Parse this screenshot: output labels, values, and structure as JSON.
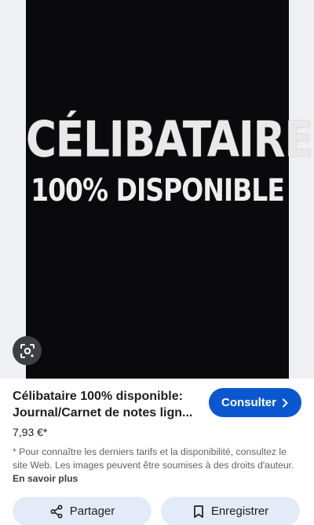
{
  "cover": {
    "title": "CÉLIBATAIRE",
    "subtitle": "100% DISPONIBLE"
  },
  "product": {
    "title_line1": "Célibataire 100% disponible:",
    "title_line2": "Journal/Carnet de notes lign...",
    "price": "7,93 €*"
  },
  "actions": {
    "consult_label": "Consulter",
    "share_label": "Partager",
    "save_label": "Enregistrer"
  },
  "disclaimer": {
    "text": "* Pour connaître les derniers tarifs et la disponibilité, consultez le site Web. Les images peuvent être soumises à des droits d'auteur.",
    "link": "En savoir plus"
  },
  "icons": {
    "lens": "lens-icon",
    "chevron": "chevron-right-icon",
    "share": "share-icon",
    "bookmark": "bookmark-icon"
  },
  "colors": {
    "accent": "#0b57d0",
    "action_bg": "#e3ebf8",
    "cover_bg": "#0a0a0c"
  }
}
